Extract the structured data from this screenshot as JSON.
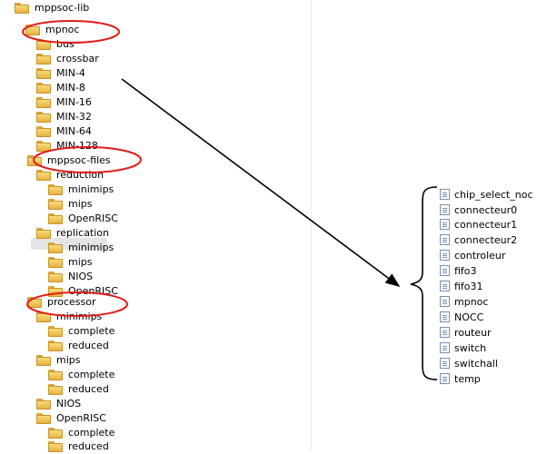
{
  "tree": {
    "rows": [
      {
        "label": "mppsoc-lib"
      },
      {
        "label": "mpnoc"
      },
      {
        "label": "bus"
      },
      {
        "label": "crossbar"
      },
      {
        "label": "MIN-4"
      },
      {
        "label": "MIN-8"
      },
      {
        "label": "MIN-16"
      },
      {
        "label": "MIN-32"
      },
      {
        "label": "MIN-64"
      },
      {
        "label": "MIN-128"
      },
      {
        "label": "mppsoc-files"
      },
      {
        "label": "reduction"
      },
      {
        "label": "minimips"
      },
      {
        "label": "mips"
      },
      {
        "label": "OpenRISC"
      },
      {
        "label": "replication"
      },
      {
        "label": "minimips"
      },
      {
        "label": "mips"
      },
      {
        "label": "NIOS"
      },
      {
        "label": "OpenRISC"
      },
      {
        "label": "processor"
      },
      {
        "label": "minimips"
      },
      {
        "label": "complete"
      },
      {
        "label": "reduced"
      },
      {
        "label": "mips"
      },
      {
        "label": "complete"
      },
      {
        "label": "reduced"
      },
      {
        "label": "NIOS"
      },
      {
        "label": "OpenRISC"
      },
      {
        "label": "complete"
      },
      {
        "label": "reduced"
      }
    ]
  },
  "files": {
    "items": [
      {
        "label": "chip_select_noc"
      },
      {
        "label": "connecteur0"
      },
      {
        "label": "connecteur1"
      },
      {
        "label": "connecteur2"
      },
      {
        "label": "controleur"
      },
      {
        "label": "fifo3"
      },
      {
        "label": "fifo31"
      },
      {
        "label": "mpnoc"
      },
      {
        "label": "NOCC"
      },
      {
        "label": "routeur"
      },
      {
        "label": "switch"
      },
      {
        "label": "switchall"
      },
      {
        "label": "temp"
      }
    ]
  },
  "annotation_color": "#e31b1b"
}
